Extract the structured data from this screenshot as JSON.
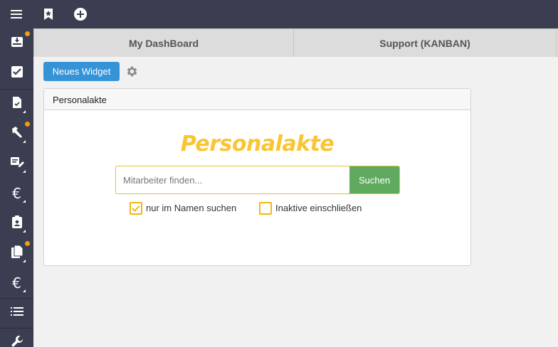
{
  "topbar": {
    "menu_icon": "hamburger-menu-icon",
    "bookmark_icon": "bookmark-star-icon",
    "add_icon": "plus-circle-icon"
  },
  "sidebar": {
    "items": [
      {
        "icon": "inbox-download-icon",
        "badge": true
      },
      {
        "icon": "checkbox-icon",
        "badge": false
      },
      {
        "icon": "document-check-icon",
        "badge": false
      },
      {
        "icon": "hammer-icon",
        "badge": true
      },
      {
        "icon": "edit-list-icon",
        "badge": false
      },
      {
        "icon": "euro-icon",
        "badge": false
      },
      {
        "icon": "clipboard-user-icon",
        "badge": false
      },
      {
        "icon": "documents-icon",
        "badge": true
      },
      {
        "icon": "euro-icon",
        "badge": false
      },
      {
        "icon": "list-icon",
        "badge": false
      },
      {
        "icon": "wrench-icon",
        "badge": false
      }
    ]
  },
  "tabs": [
    {
      "label": "My DashBoard"
    },
    {
      "label": "Support (KANBAN)"
    }
  ],
  "toolbar": {
    "new_widget_label": "Neues Widget",
    "settings_icon": "gear-icon"
  },
  "widget": {
    "header": "Personalakte",
    "title": "Personalakte",
    "search_placeholder": "Mitarbeiter finden...",
    "search_button": "Suchen",
    "checkbox_name_only": {
      "label": "nur im Namen suchen",
      "checked": true
    },
    "checkbox_inactive": {
      "label": "Inaktive einschließen",
      "checked": false
    }
  },
  "colors": {
    "dark_bar": "#3a3e50",
    "primary": "#3593d8",
    "success": "#5faa5f",
    "accent_yellow": "#f9c531",
    "badge_orange": "#f39c12"
  }
}
